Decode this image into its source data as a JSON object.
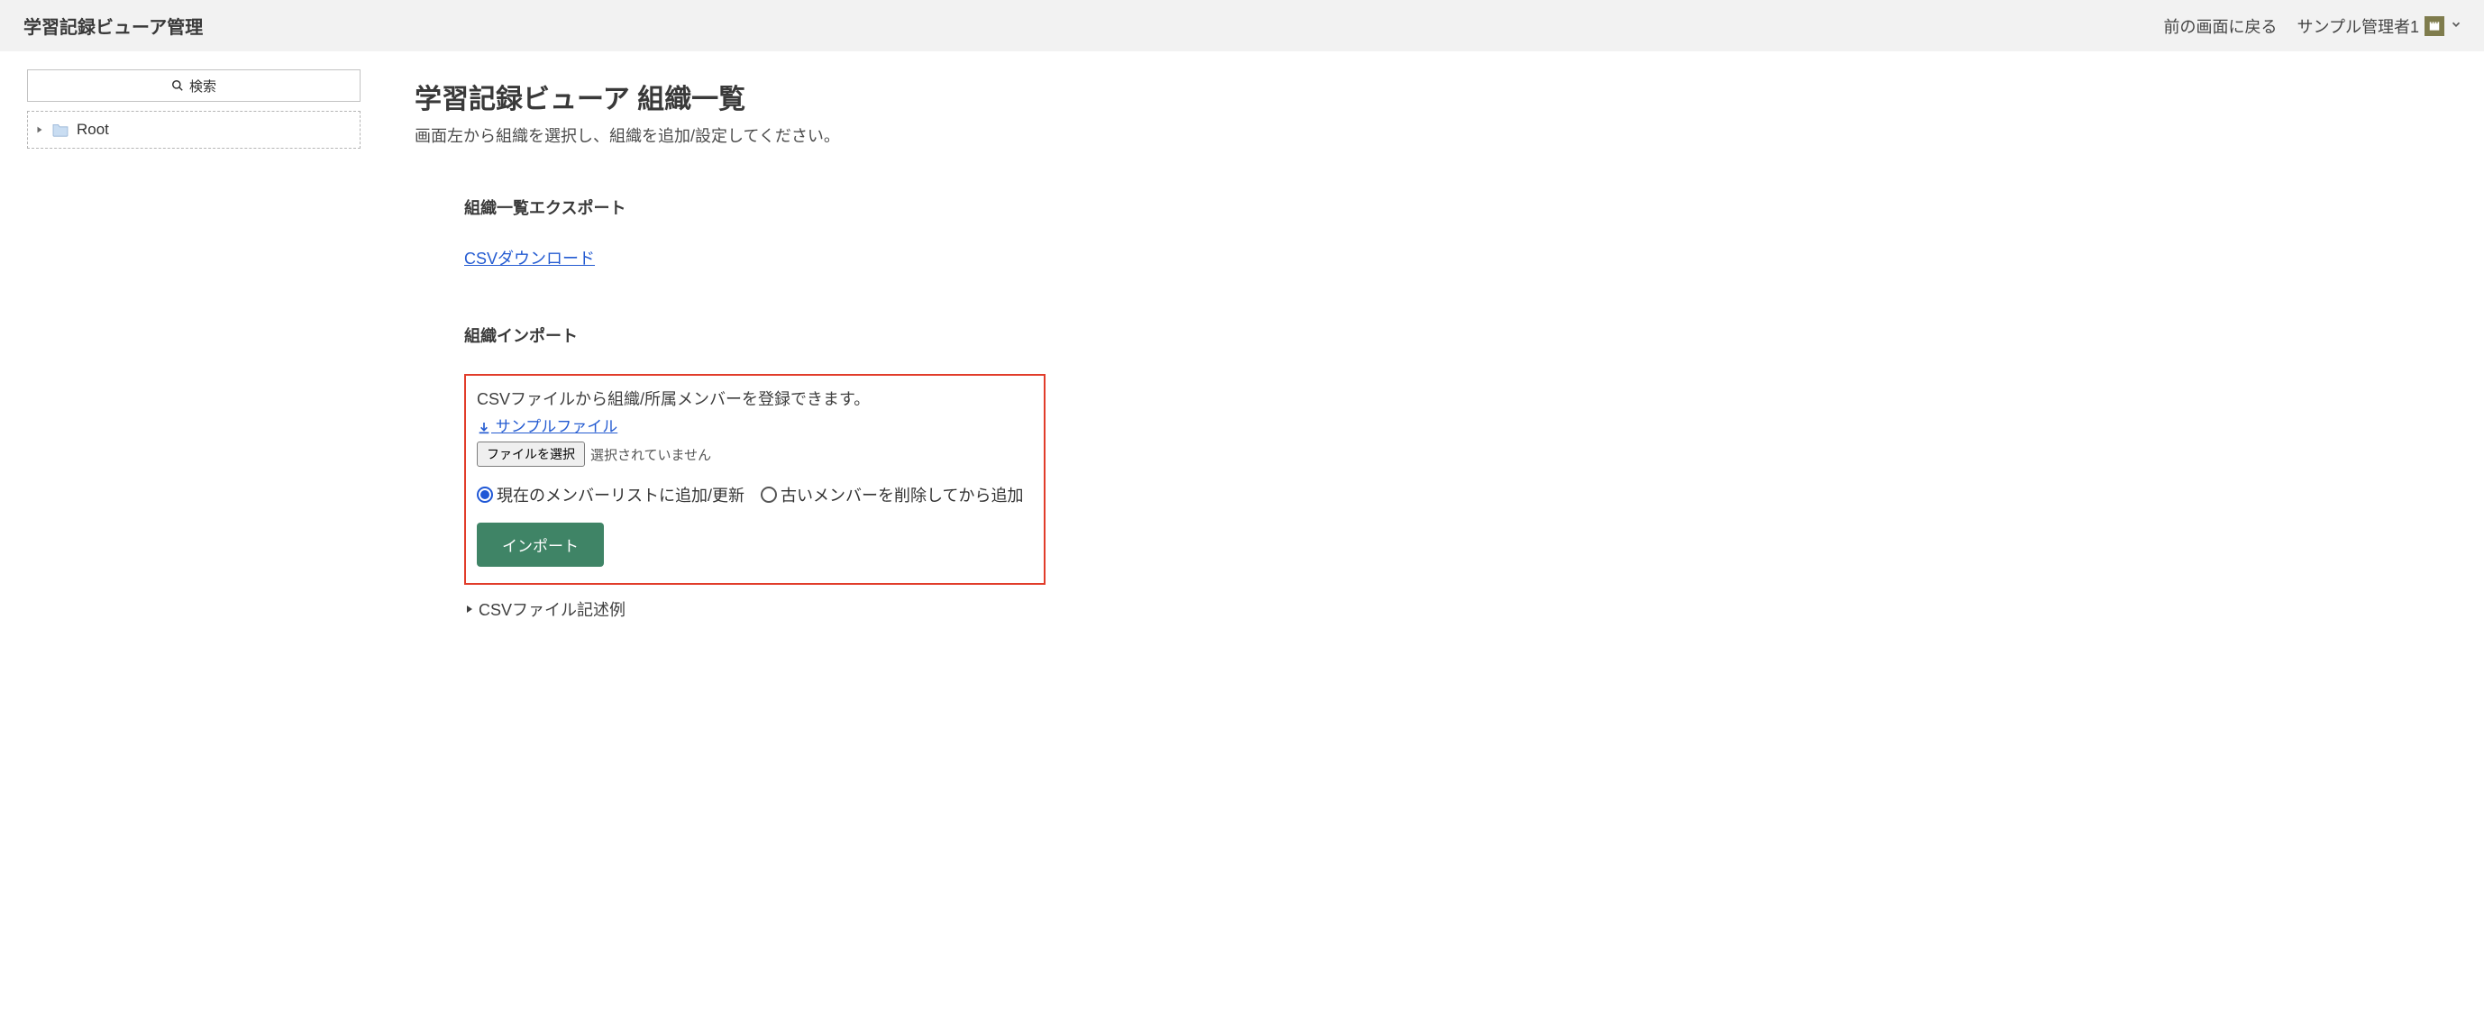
{
  "header": {
    "title": "学習記録ビューア管理",
    "back_label": "前の画面に戻る",
    "user_name": "サンプル管理者1"
  },
  "sidebar": {
    "search_placeholder": "検索",
    "tree": {
      "root_label": "Root"
    }
  },
  "main": {
    "title": "学習記録ビューア 組織一覧",
    "subtitle": "画面左から組織を選択し、組織を追加/設定してください。",
    "export": {
      "heading": "組織一覧エクスポート",
      "csv_link": "CSVダウンロード"
    },
    "import": {
      "heading": "組織インポート",
      "description": "CSVファイルから組織/所属メンバーを登録できます。",
      "sample_link": " サンプルファイル",
      "file_button_label": "ファイルを選択",
      "file_status": "選択されていません",
      "radio_option1": "現在のメンバーリストに追加/更新",
      "radio_option2": "古いメンバーを削除してから追加",
      "submit_label": "インポート",
      "csv_example_label": "CSVファイル記述例"
    }
  }
}
